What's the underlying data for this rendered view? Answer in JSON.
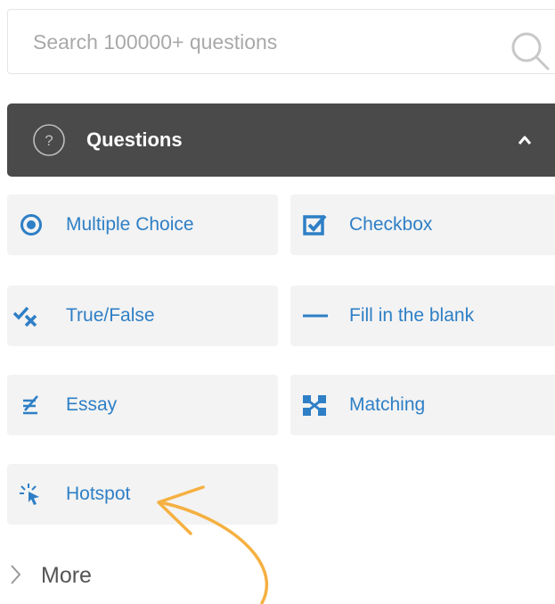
{
  "search": {
    "placeholder": "Search 100000+ questions",
    "value": ""
  },
  "header": {
    "title": "Questions",
    "icon": "question-circle-icon",
    "toggle_icon": "chevron-up-icon"
  },
  "question_types": [
    {
      "label": "Multiple Choice",
      "icon": "radio-icon"
    },
    {
      "label": "Checkbox",
      "icon": "checkbox-icon"
    },
    {
      "label": "True/False",
      "icon": "true-false-icon"
    },
    {
      "label": "Fill in the blank",
      "icon": "blank-line-icon"
    },
    {
      "label": "Essay",
      "icon": "essay-icon"
    },
    {
      "label": "Matching",
      "icon": "matching-icon"
    },
    {
      "label": "Hotspot",
      "icon": "hotspot-icon"
    }
  ],
  "more": {
    "label": "More",
    "icon": "chevron-right-icon"
  },
  "colors": {
    "accent": "#2e7fc6",
    "header_bg": "#4a4a4a",
    "tile_bg": "#f3f3f3",
    "annotation_arrow": "#f5b041"
  }
}
